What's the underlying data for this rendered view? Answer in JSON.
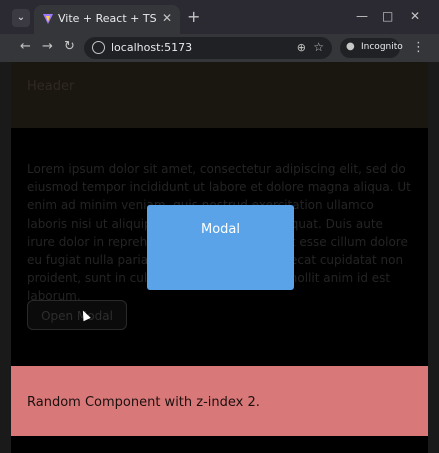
{
  "browser": {
    "tab_title": "Vite + React + TS",
    "url": "localhost:5173",
    "incognito_label": "Incognito",
    "icons": {
      "tab_search": "chevron-down-icon",
      "favicon": "vite-logo-icon",
      "tab_close": "close-icon",
      "new_tab": "plus-icon",
      "minimize": "minimize-icon",
      "maximize": "maximize-icon",
      "close_window": "close-icon",
      "back": "arrow-left-icon",
      "forward": "arrow-right-icon",
      "reload": "reload-icon",
      "site_info": "site-info-icon",
      "zoom": "zoom-icon",
      "bookmark": "star-icon",
      "incognito": "incognito-icon",
      "menu": "kebab-icon"
    }
  },
  "page": {
    "header": "Header",
    "body_text": "Lorem ipsum dolor sit amet, consectetur adipiscing elit, sed do eiusmod tempor incididunt ut labore et dolore magna aliqua. Ut enim ad minim veniam, quis nostrud exercitation ullamco laboris nisi ut aliquip ex ea commodo consequat. Duis aute irure dolor in reprehenderit in voluptate velit esse cillum dolore eu fugiat nulla pariatur. Excepteur sint occaecat cupidatat non proident, sunt in culpa qui officia deserunt mollit anim id est laborum.",
    "open_button": "Open Modal",
    "random_component": "Random Component with z-index 2.",
    "modal_title": "Modal"
  },
  "colors": {
    "modal_background": "#5aa3e8",
    "random_component_background": "#d97878",
    "overlay": "#000000"
  }
}
